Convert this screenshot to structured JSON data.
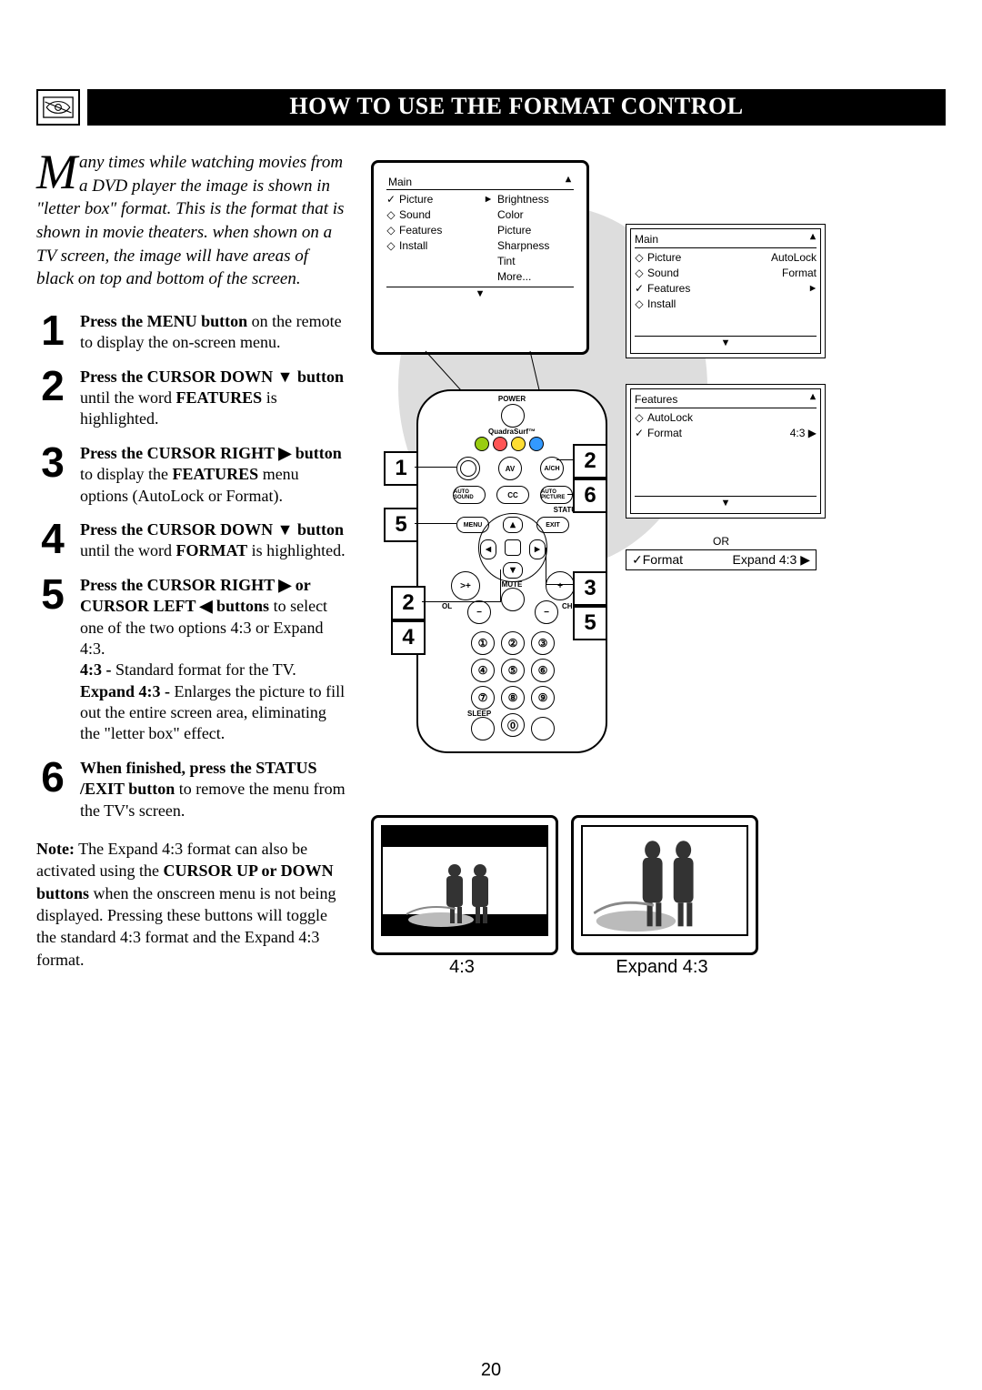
{
  "header": {
    "title": "HOW TO USE THE FORMAT CONTROL"
  },
  "intro": {
    "dropcap": "M",
    "text": "any times while watching movies from a DVD player the image is shown in \"letter box\" format. This is the format that is shown in movie theaters. when shown on a TV screen, the image will have areas of black on top and bottom of the screen."
  },
  "steps": {
    "s1": {
      "pre": "Press the MENU button",
      "post": " on the remote to display the on-screen menu."
    },
    "s2": {
      "pre": "Press the CURSOR DOWN ▼ button",
      "post": " until the word ",
      "b2": "FEATURES",
      "post2": " is highlighted."
    },
    "s3": {
      "pre": "Press the CURSOR RIGHT ▶ button",
      "post": " to display the ",
      "b2": "FEATURES",
      "post2": " menu options (AutoLock or Format)."
    },
    "s4": {
      "pre": "Press the CURSOR DOWN ▼ button",
      "post": " until the word ",
      "b2": "FORMAT",
      "post2": " is highlighted."
    },
    "s5": {
      "pre": "Press the CURSOR RIGHT ▶ or CURSOR LEFT ◀ buttons",
      "post": " to select one of the two options 4:3 or Expand 4:3.",
      "l1": "4:3 - ",
      "l1b": "Standard format for the TV.",
      "l2": "Expand 4:3 - ",
      "l2b": "Enlarges the picture to fill out the entire screen area, eliminating the \"letter box\" effect."
    },
    "s6": {
      "pre": "When finished, press the STATUS /EXIT button",
      "post": " to remove the menu from the TV's screen."
    }
  },
  "note": {
    "lead": "Note:",
    "text": " The Expand 4:3 format can also be activated using the ",
    "b1": "CURSOR UP or DOWN buttons",
    "text2": " when the onscreen menu is not being displayed. Pressing these buttons will toggle the standard 4:3 format and the Expand 4:3 format."
  },
  "menu_picture": {
    "title": "Main",
    "left": [
      "Picture",
      "Sound",
      "Features",
      "Install"
    ],
    "left_marks": [
      "✓",
      "◇",
      "◇",
      "◇"
    ],
    "right": [
      "Brightness",
      "Color",
      "Picture",
      "Sharpness",
      "Tint",
      "More..."
    ]
  },
  "panel_main": {
    "title": "Main",
    "rows": [
      {
        "mk": "◇",
        "label": "Picture",
        "right": "AutoLock"
      },
      {
        "mk": "◇",
        "label": "Sound",
        "right": "Format"
      },
      {
        "mk": "✓",
        "label": "Features",
        "right": ""
      },
      {
        "mk": "◇",
        "label": "Install",
        "right": ""
      }
    ]
  },
  "panel_features": {
    "title": "Features",
    "rows": [
      {
        "mk": "◇",
        "label": "AutoLock",
        "right": ""
      },
      {
        "mk": "✓",
        "label": "Format",
        "right": "4:3 ▶"
      }
    ]
  },
  "or_label": "OR",
  "format_bar": {
    "left": "✓Format",
    "right": "Expand 4:3 ▶"
  },
  "remote": {
    "power": "POWER",
    "brand": "QuadraSurf™",
    "av": "AV",
    "ach": "A/CH",
    "auto_sound": "AUTO SOUND",
    "cc": "CC",
    "auto_picture": "AUTO PICTURE",
    "menu": "MENU",
    "exit": "EXIT",
    "status": "STATUS",
    "mute": "MUTE",
    "vol": "OL",
    "ch": "CH",
    "sleep": "SLEEP"
  },
  "samples": {
    "a": "4:3",
    "b": "Expand 4:3"
  },
  "page_number": "20"
}
